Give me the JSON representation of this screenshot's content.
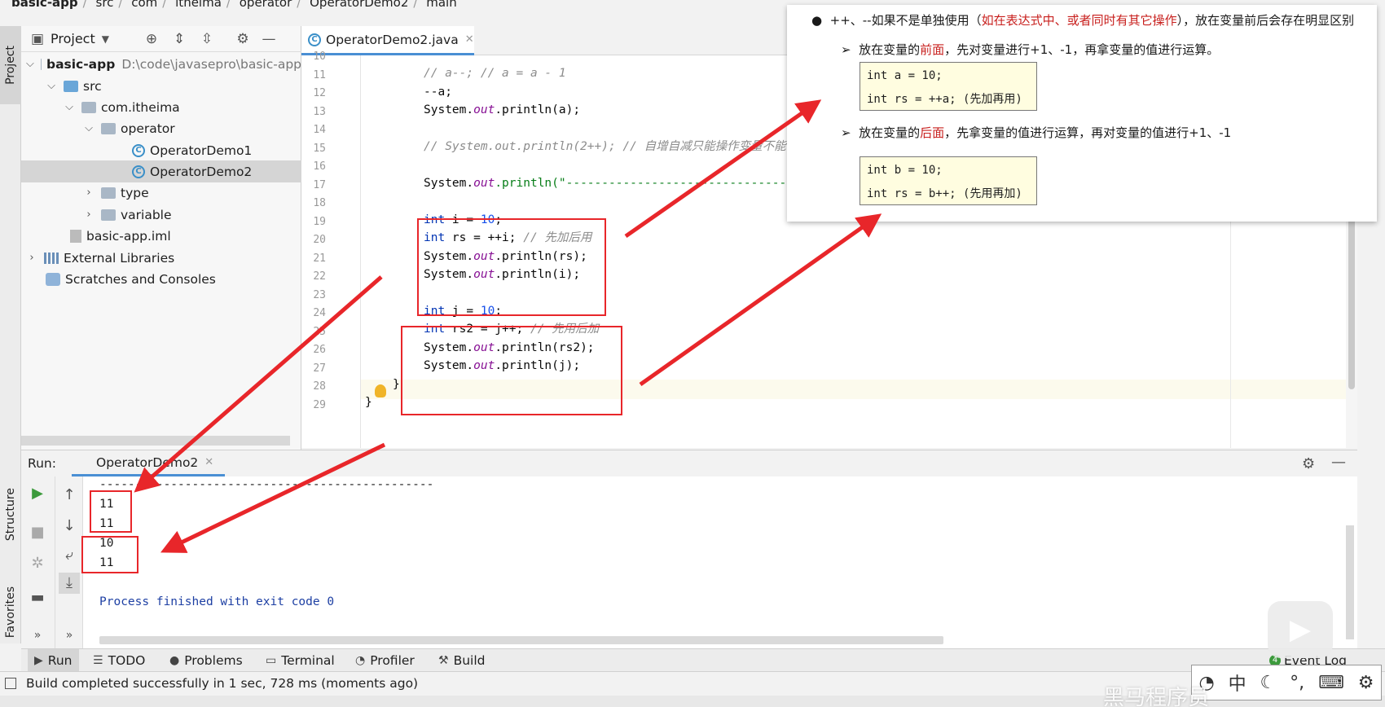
{
  "breadcrumb": {
    "items": [
      "basic-app",
      "src",
      "com",
      "itheima",
      "operator",
      "OperatorDemo2",
      "main"
    ]
  },
  "left_stripe": {
    "project_tab": "Project",
    "structure_tab": "Structure",
    "favorites_tab": "Favorites"
  },
  "project_panel": {
    "title": "Project",
    "tree": [
      {
        "label": "basic-app",
        "path": "D:\\code\\javasepro\\basic-app",
        "kind": "module"
      },
      {
        "label": "src",
        "kind": "folder"
      },
      {
        "label": "com.itheima",
        "kind": "package"
      },
      {
        "label": "operator",
        "kind": "package"
      },
      {
        "label": "OperatorDemo1",
        "kind": "class"
      },
      {
        "label": "OperatorDemo2",
        "kind": "class",
        "selected": true
      },
      {
        "label": "type",
        "kind": "package"
      },
      {
        "label": "variable",
        "kind": "package"
      },
      {
        "label": "basic-app.iml",
        "kind": "file"
      },
      {
        "label": "External Libraries",
        "kind": "lib"
      },
      {
        "label": "Scratches and Consoles",
        "kind": "scratch"
      }
    ]
  },
  "editor": {
    "tab_label": "OperatorDemo2.java",
    "line_numbers": [
      "10",
      "11",
      "12",
      "13",
      "14",
      "15",
      "16",
      "17",
      "18",
      "19",
      "20",
      "21",
      "22",
      "23",
      "24",
      "25",
      "26",
      "27",
      "28",
      "29"
    ],
    "code": {
      "l11a": "// a--; // a = a - 1",
      "l12a": "--a;",
      "l13a": "System.",
      "l13b": "out",
      "l13c": ".println(a);",
      "l15a": "// System.out.println(2++); // 自增自减只能操作变量不能",
      "l17a": "System.",
      "l17b": "out",
      "l17c": ".println(\"-----------------------------------------",
      "l19a": "int",
      "l19b": " i = ",
      "l19c": "10",
      "l19d": ";",
      "l20a": "int",
      "l20b": " rs = ++i; ",
      "l20c": "// 先加后用",
      "l21a": "System.",
      "l21b": "out",
      "l21c": ".println(rs);",
      "l22a": "System.",
      "l22b": "out",
      "l22c": ".println(i);",
      "l24a": "int",
      "l24b": " j = ",
      "l24c": "10",
      "l24d": ";",
      "l25a": "int",
      "l25b": " rs2 = j++; ",
      "l25c": "// 先用后加",
      "l26a": "System.",
      "l26b": "out",
      "l26c": ".println(rs2);",
      "l27a": "System.",
      "l27b": "out",
      "l27c": ".println(j);",
      "l28": "}",
      "l29": "}"
    }
  },
  "doc_overlay": {
    "bullet": "++、--如果不是单独使用（",
    "bullet_red": "如在表达式中、或者同时有其它操作",
    "bullet_tail": "），放在变量前后会存在明显区别",
    "pre_line_a": "放在变量的",
    "pre_line_red": "前面",
    "pre_line_b": "，先对变量进行+1、-1，再拿变量的值进行运算。",
    "pre_code_1": "int a = 10;",
    "pre_code_2": "int rs = ++a; (先加再用)",
    "post_line_a": "放在变量的",
    "post_line_red": "后面",
    "post_line_b": "，先拿变量的值进行运算，再对变量的值进行+1、-1",
    "post_code_1": "int b = 10;",
    "post_code_2": "int rs = b++; (先用再加)"
  },
  "run_panel": {
    "label": "Run:",
    "tab_label": "OperatorDemo2",
    "console": {
      "divider": "-----------------------------------------------",
      "out1": "11",
      "out2": "11",
      "out3": "10",
      "out4": "11",
      "finish": "Process finished with exit code 0"
    }
  },
  "tool_tabs": {
    "run": "Run",
    "todo": "TODO",
    "problems": "Problems",
    "terminal": "Terminal",
    "profiler": "Profiler",
    "build": "Build",
    "event_log": "Event Log",
    "event_count": "4"
  },
  "status_bar": {
    "text": "Build completed successfully in 1 sec, 728 ms (moments ago)"
  },
  "ime": {
    "lang": "中"
  },
  "watermark": {
    "text": "黑马程序员"
  },
  "colors": {
    "accent": "#4a8fd4",
    "highlight_red": "#e8262a",
    "keyword": "#0033b3",
    "number": "#1750eb"
  }
}
